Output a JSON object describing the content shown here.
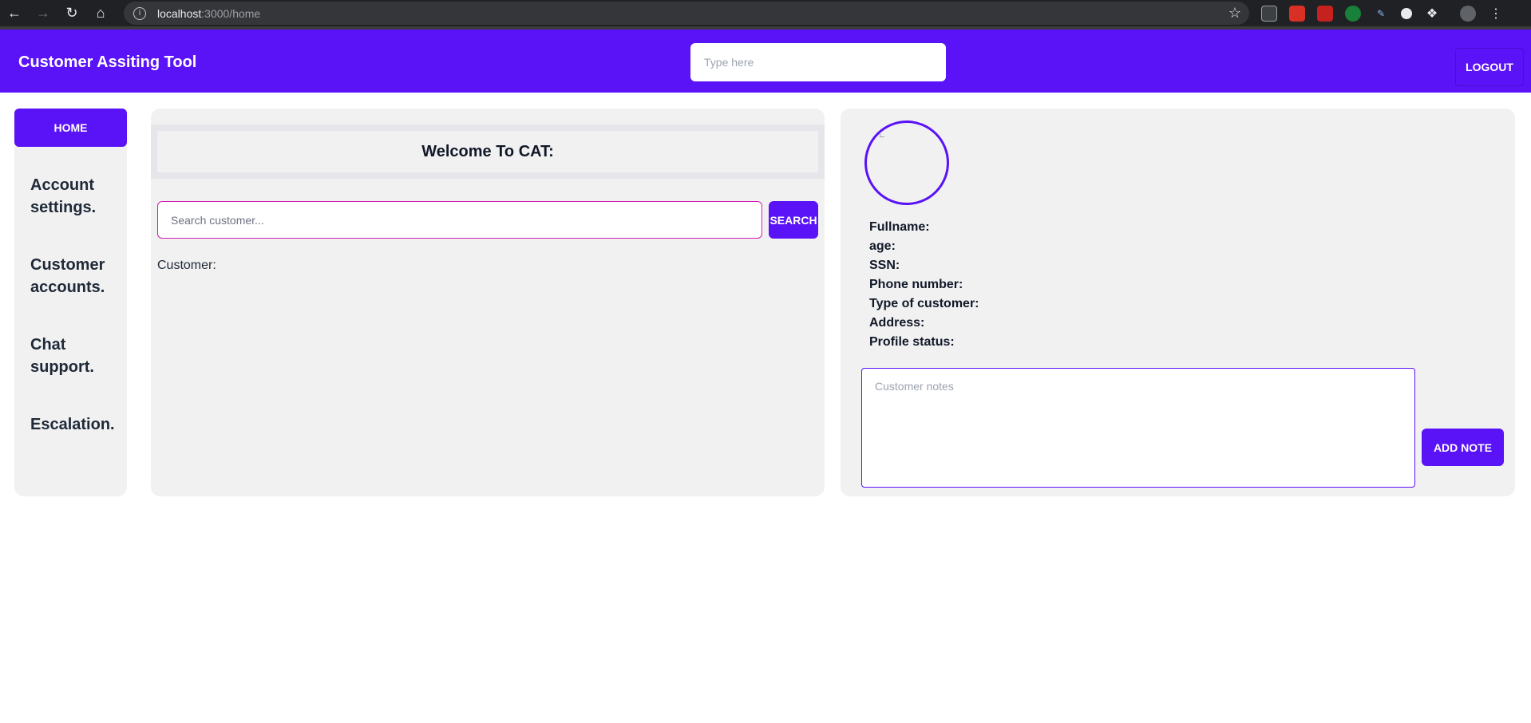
{
  "browser": {
    "url_host": "localhost",
    "url_rest": ":3000/home",
    "icons": [
      "back-icon",
      "forward-icon",
      "reload-icon",
      "home-icon",
      "info-icon",
      "star-icon",
      "extensions-icon",
      "profile-icon",
      "menu-icon"
    ]
  },
  "header": {
    "title": "Customer Assiting Tool",
    "search_placeholder": "Type here",
    "logout_label": "LOGOUT"
  },
  "sidebar": {
    "home_label": "HOME",
    "items": [
      {
        "label": "Account settings."
      },
      {
        "label": "Customer accounts."
      },
      {
        "label": "Chat support."
      },
      {
        "label": "Escalation."
      }
    ]
  },
  "main": {
    "welcome": "Welcome To CAT:",
    "search_placeholder": "Search customer...",
    "search_button": "SEARCH",
    "customer_label": "Customer:"
  },
  "profile": {
    "fields": [
      "Fullname:",
      "age:",
      "SSN:",
      "Phone number:",
      "Type of customer:",
      "Address:",
      "Profile status:"
    ],
    "notes_placeholder": "Customer notes",
    "add_note_button": "ADD NOTE"
  },
  "colors": {
    "primary": "#5a12f7",
    "panel": "#f1f1f2",
    "search_border": "#d11bb5"
  }
}
